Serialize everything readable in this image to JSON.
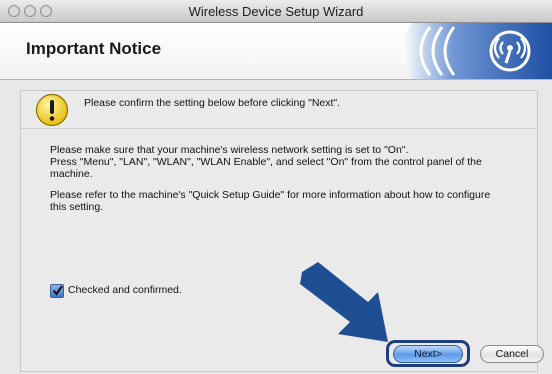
{
  "window": {
    "title": "Wireless Device Setup Wizard",
    "traffic_lights": [
      "close",
      "minimize",
      "zoom"
    ]
  },
  "header": {
    "heading": "Important Notice",
    "logo_icon": "wireless-signal-icon"
  },
  "notice": {
    "icon": "warning-icon",
    "text": "Please confirm the setting below before clicking \"Next\"."
  },
  "body": {
    "paragraph1": "Please make sure that your machine's wireless network setting is set to \"On\".\nPress \"Menu\", \"LAN\", \"WLAN\", \"WLAN Enable\", and select \"On\" from the control panel of the\nmachine.",
    "paragraph2": "Please refer to the machine's \"Quick Setup Guide\" for more information about how to configure\nthis setting."
  },
  "confirmation": {
    "checked": true,
    "label": "Checked and confirmed."
  },
  "buttons": {
    "next": "Next>",
    "cancel": "Cancel"
  },
  "colors": {
    "arrow": "#1f4e93",
    "focus_ring": "#1e3d7d",
    "logo_blue": "#1d4fa3"
  }
}
